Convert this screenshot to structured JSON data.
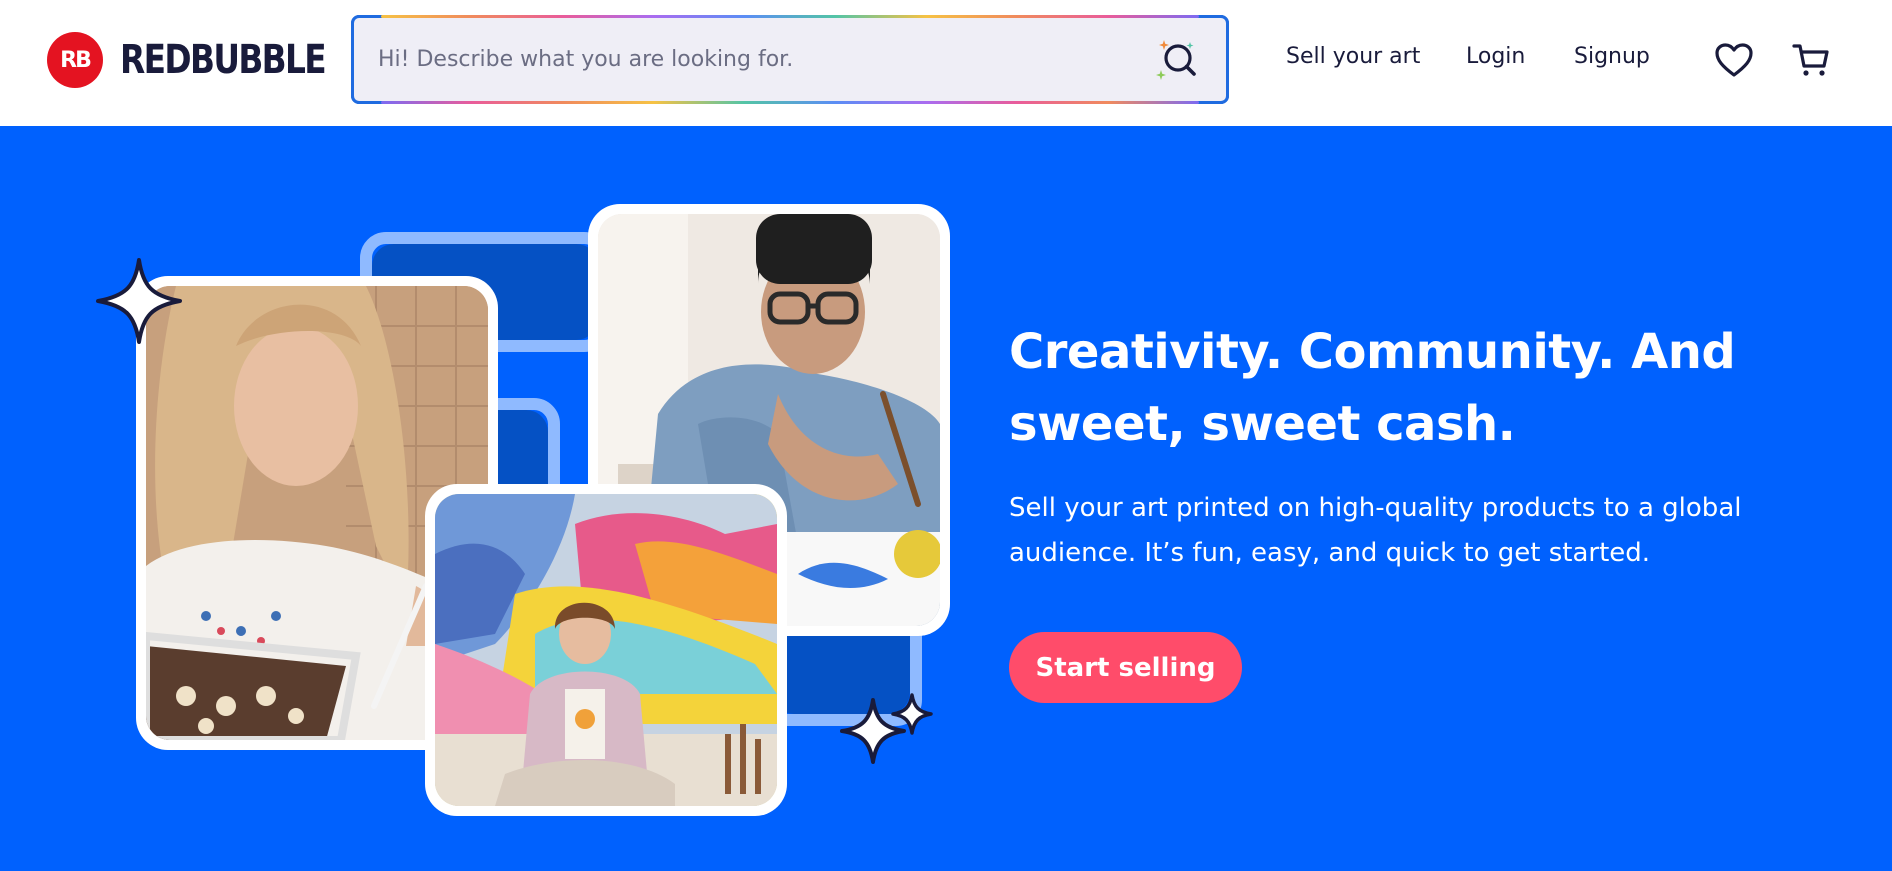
{
  "header": {
    "logo_mark": "RB",
    "logo_text": "REDBUBBLE",
    "search": {
      "placeholder": "Hi! Describe what you are looking for."
    },
    "nav": {
      "sell": "Sell your art",
      "login": "Login",
      "signup": "Signup"
    },
    "icons": {
      "search": "ai-search-icon",
      "heart": "heart-icon",
      "cart": "cart-icon"
    }
  },
  "hero": {
    "title": "Creativity. Community. And sweet, sweet cash.",
    "subtitle": "Sell your art printed on high-quality products to a global audience. It’s fun, easy, and quick to get started.",
    "cta_label": "Start selling",
    "photos": [
      "artist-drawing-on-tablet-photo",
      "artist-painting-watercolor-photo",
      "artist-with-mural-photo"
    ]
  },
  "colors": {
    "brand_red": "#e41321",
    "hero_blue": "#0061fe",
    "cta_pink": "#ff4c6a",
    "text_dark": "#191b3b"
  }
}
